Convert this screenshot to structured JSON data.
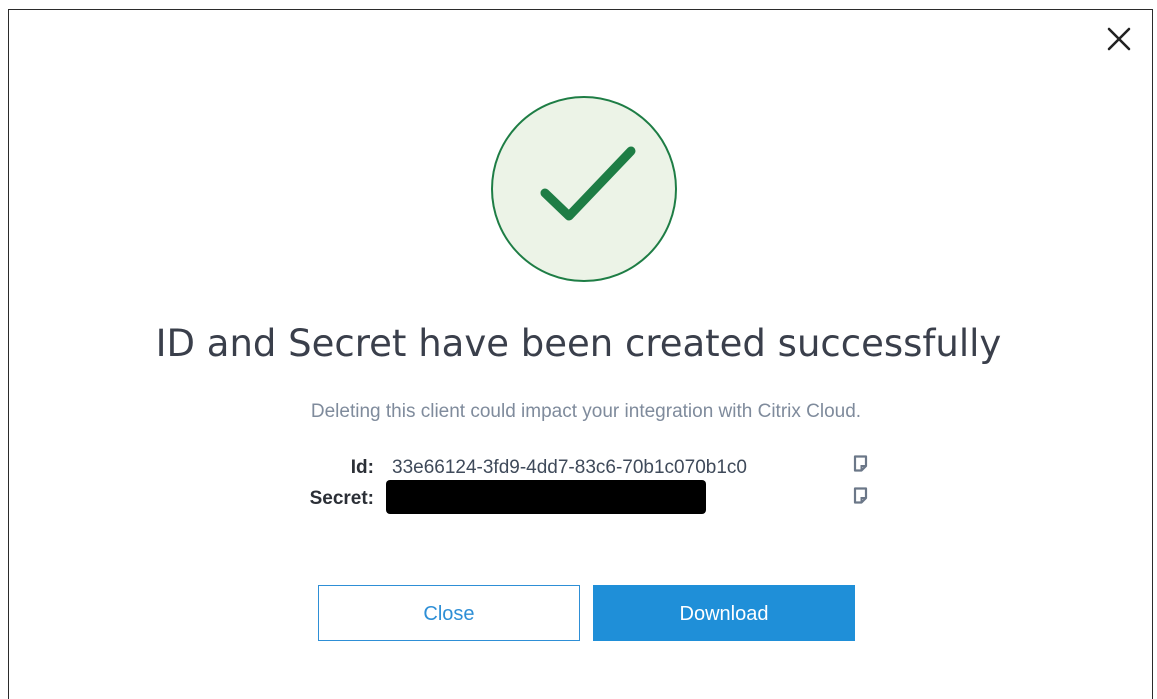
{
  "dialog": {
    "title": "ID and Secret have been created successfully",
    "subtitle": "Deleting this client could impact your integration with Citrix Cloud.",
    "credentials": {
      "id_label": "Id:",
      "id_value": "33e66124-3fd9-4dd7-83c6-70b1c070b1c0",
      "secret_label": "Secret:"
    },
    "buttons": {
      "close_label": "Close",
      "download_label": "Download"
    },
    "icons": {
      "dismiss": "close-icon",
      "success": "checkmark-icon",
      "copy": "copy-icon"
    },
    "colors": {
      "success_green": "#1e7d45",
      "success_bg": "#ecf3e7",
      "primary_blue": "#1f8fd8",
      "title_text": "#3a3f4b",
      "subtitle_text": "#7f8b9c"
    }
  }
}
